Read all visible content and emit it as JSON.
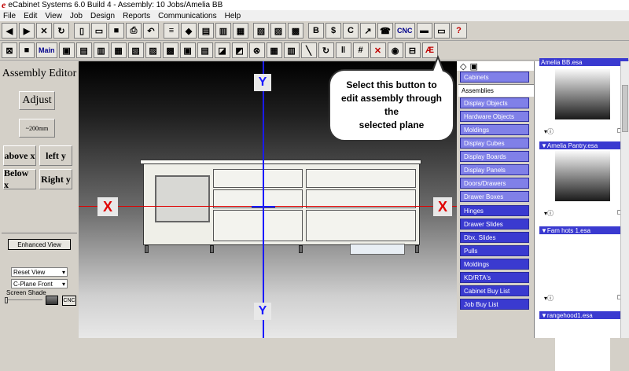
{
  "window": {
    "title": "eCabinet Systems 6.0 Build 4 - Assembly: 10 Jobs/Amelia BB",
    "logo": "e"
  },
  "menu": [
    "File",
    "Edit",
    "View",
    "Job",
    "Design",
    "Reports",
    "Communications",
    "Help"
  ],
  "toolbar1": {
    "cnc_label": "CNC"
  },
  "toolbar2": {
    "main_label": "Main"
  },
  "left_panel": {
    "title": "Assembly Editor",
    "adjust": "Adjust",
    "increment": "~200mm",
    "above_x": "above x",
    "left_y": "left y",
    "below_x": "Below  x",
    "right_y": "Right  y",
    "enhanced_view": "Enhanced View",
    "reset_view": "Reset View",
    "cplane": "C-Plane Front",
    "screen_shade": "Screen Shade",
    "cnc": "CNC",
    "mini_axis": "Y"
  },
  "viewport": {
    "y_label": "Y",
    "x_label": "X"
  },
  "callout": {
    "text_lines": [
      "Select this button to",
      "edit assembly through",
      "the",
      "selected plane"
    ]
  },
  "categories": [
    {
      "label": "Cabinets",
      "style": "light"
    },
    {
      "label": "Assemblies",
      "style": "active"
    },
    {
      "label": "Display Objects",
      "style": "light"
    },
    {
      "label": "Hardware Objects",
      "style": "light"
    },
    {
      "label": "Moldings",
      "style": "light"
    },
    {
      "label": "Display Cubes",
      "style": "light"
    },
    {
      "label": "Display Boards",
      "style": "light"
    },
    {
      "label": "Display Panels",
      "style": "light"
    },
    {
      "label": "Doors/Drawers",
      "style": "light"
    },
    {
      "label": "Drawer Boxes",
      "style": "light"
    },
    {
      "label": "Hinges",
      "style": "dark"
    },
    {
      "label": "Drawer Slides",
      "style": "dark"
    },
    {
      "label": "Dbx. Slides",
      "style": "dark"
    },
    {
      "label": "Pulls",
      "style": "dark"
    },
    {
      "label": "Moldings",
      "style": "dark"
    },
    {
      "label": "KD/RTA's",
      "style": "dark"
    },
    {
      "label": "Cabinet Buy List",
      "style": "dark"
    },
    {
      "label": "Job Buy List",
      "style": "dark"
    }
  ],
  "thumbnails": [
    {
      "name": "Amelia BB.esa"
    },
    {
      "name": "Amelia Pantry.esa"
    },
    {
      "name": "Fam hots 1.esa"
    },
    {
      "name": "rangehood1.esa"
    }
  ],
  "colors": {
    "axis_y": "#1a1aff",
    "axis_x": "#e00000",
    "category_light": "#8080e8",
    "category_dark": "#3a3ad0"
  }
}
